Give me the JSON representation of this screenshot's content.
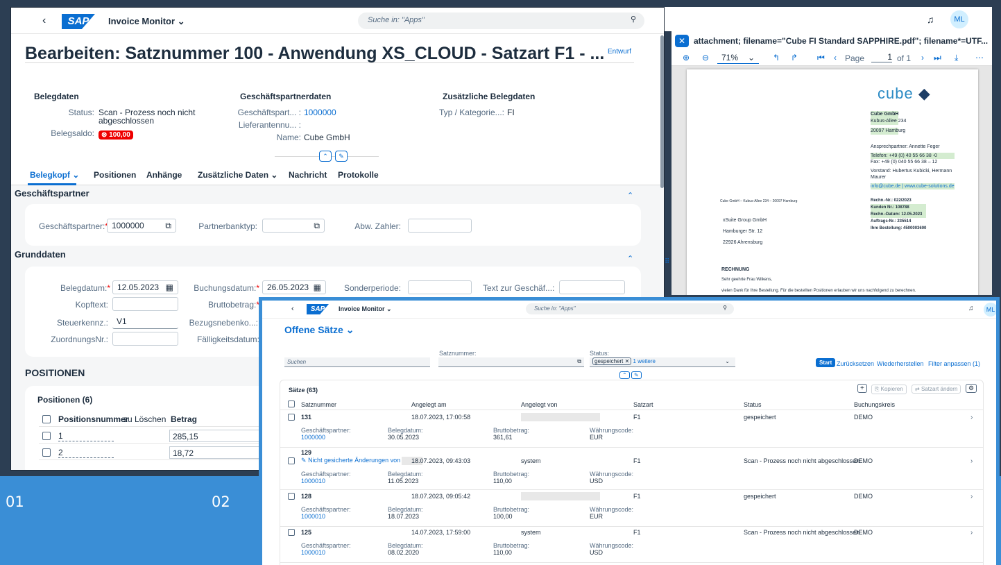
{
  "slide": {
    "num1": "01",
    "num2": "02"
  },
  "win1": {
    "app_title": "Invoice Monitor",
    "search_placeholder": "Suche in: \"Apps\"",
    "avatar": "ML",
    "page_title": "Bearbeiten: Satznummer 100 - Anwendung XS_CLOUD - Satzart F1 - ...",
    "draft": "Entwurf",
    "belegdaten": {
      "title": "Belegdaten",
      "status_lbl": "Status:",
      "status_val1": "Scan - Prozess noch nicht",
      "status_val2": "abgeschlossen",
      "saldo_lbl": "Belegsaldo:",
      "saldo_val": "100,00"
    },
    "gp": {
      "title": "Geschäftspartnerdaten",
      "gp_lbl": "Geschäftspart... :",
      "gp_val": "1000000",
      "lief_lbl": "Lieferantennu... :",
      "name_lbl": "Name:",
      "name_val": "Cube GmbH"
    },
    "zus": {
      "title": "Zusätzliche Belegdaten",
      "typ_lbl": "Typ / Kategorie...:",
      "typ_val": "FI"
    },
    "tabs": [
      "Belegkopf",
      "Positionen",
      "Anhänge",
      "Zusätzliche Daten",
      "Nachricht",
      "Protokolle"
    ],
    "sec1": {
      "title": "Geschäftspartner",
      "gp_lbl": "Geschäftspartner:",
      "gp_val": "1000000",
      "pbt_lbl": "Partnerbanktyp:",
      "abw_lbl": "Abw. Zahler:"
    },
    "sec2": {
      "title": "Grunddaten",
      "beleg_lbl": "Belegdatum:",
      "beleg_val": "12.05.2023",
      "buch_lbl": "Buchungsdatum:",
      "buch_val": "26.05.2023",
      "sonder_lbl": "Sonderperiode:",
      "text_lbl": "Text zur Geschäf...:",
      "kopf_lbl": "Kopftext:",
      "brutto_lbl": "Bruttobetrag:",
      "steuer_lbl": "Steuerkennz.:",
      "steuer_val": "V1",
      "bezug_lbl": "Bezugsnebenko...:",
      "zuord_lbl": "ZuordnungsNr.:",
      "faell_lbl": "Fälligkeitsdatum:"
    },
    "positionen": {
      "heading": "POSITIONEN",
      "table_title": "Positionen (6)",
      "cols": [
        "Positionsnummer",
        "zu Löschen",
        "Betrag"
      ],
      "rows": [
        {
          "nr": "1",
          "betrag": "285,15"
        },
        {
          "nr": "2",
          "betrag": "18,72"
        }
      ]
    }
  },
  "pdf": {
    "title": "attachment; filename=\"Cube FI Standard SAPPHIRE.pdf\"; filename*=UTF...",
    "zoom": "71%",
    "page_lbl": "Page",
    "page_val": "1",
    "of": "of 1",
    "logo": "cube",
    "sender": [
      "Cube GmbH",
      "Kubus-Allee 234",
      "20097 Hamburg"
    ],
    "contact": [
      "Ansprechpartner: Annette Feger",
      "Telefon: +49 (0) 40 55 66 38 -0",
      "Fax: +49 (0) 040 55 66 38 – 12",
      "Vorstand: Hubertus Kubicki, Hermann",
      "Maurer",
      "info@cube.de | www.cube-solutions.de"
    ],
    "sender_line": "Cube GmbH – Kubus-Allee 234 – 20097 Hamburg",
    "recipient": [
      "xSuite Group GmbH",
      "Hamburger Str. 12",
      "22926 Ahrensburg"
    ],
    "meta": [
      "Rechn.-Nr.: 022/2023",
      "Kunden Nr.: 108788",
      "Rechn.-Datum: 12.05.2023",
      "Auftrags-Nr.: 235514",
      "Ihre Bestellung: 4500003600"
    ],
    "rechnung": "RECHNUNG",
    "greeting": "Sehr geehrte Frau Wilkens,",
    "text": "vielen Dank für Ihre Bestellung. Für die bestellten Positionen erlauben wir uns nachfolgend zu berechnen."
  },
  "win2": {
    "app_title": "Invoice Monitor",
    "search_placeholder": "Suche in: \"Apps\"",
    "avatar": "ML",
    "page_title": "Offene Sätze",
    "filter": {
      "search_ph": "Suchen",
      "satz_lbl": "Satznummer:",
      "status_lbl": "Status:",
      "token": "gespeichert",
      "more": "1 weitere",
      "start": "Start",
      "reset": "Zurücksetzen",
      "restore": "Wiederherstellen",
      "adapt": "Filter anpassen (1)"
    },
    "table": {
      "title": "Sätze (63)",
      "copy": "Kopieren",
      "change": "Satzart ändern",
      "cols": [
        "Satznummer",
        "Angelegt am",
        "Angelegt von",
        "Satzart",
        "Status",
        "Buchungskreis"
      ],
      "sub_lbls": [
        "Geschäftspartner:",
        "Belegdatum:",
        "Bruttobetrag:",
        "Währungscode:"
      ],
      "rows": [
        {
          "nr": "131",
          "date": "18.07.2023, 17:00:58",
          "by": "",
          "art": "F1",
          "status": "gespeichert",
          "bk": "DEMO",
          "gp": "1000000",
          "bd": "30.05.2023",
          "bb": "361,61",
          "wc": "EUR"
        },
        {
          "nr": "129",
          "note": "Nicht gesicherte Änderungen von",
          "date": "18.07.2023, 09:43:03",
          "by": "system",
          "art": "F1",
          "status": "Scan - Prozess noch nicht abgeschlossen",
          "bk": "DEMO",
          "gp": "1000010",
          "bd": "11.05.2023",
          "bb": "110,00",
          "wc": "USD"
        },
        {
          "nr": "128",
          "date": "18.07.2023, 09:05:42",
          "by": "",
          "art": "F1",
          "status": "gespeichert",
          "bk": "DEMO",
          "gp": "1000010",
          "bd": "18.07.2023",
          "bb": "100,00",
          "wc": "EUR"
        },
        {
          "nr": "125",
          "date": "14.07.2023, 17:59:00",
          "by": "system",
          "art": "F1",
          "status": "Scan - Prozess noch nicht abgeschlossen",
          "bk": "DEMO",
          "gp": "1000010",
          "bd": "08.02.2020",
          "bb": "110,00",
          "wc": "USD"
        }
      ]
    }
  }
}
